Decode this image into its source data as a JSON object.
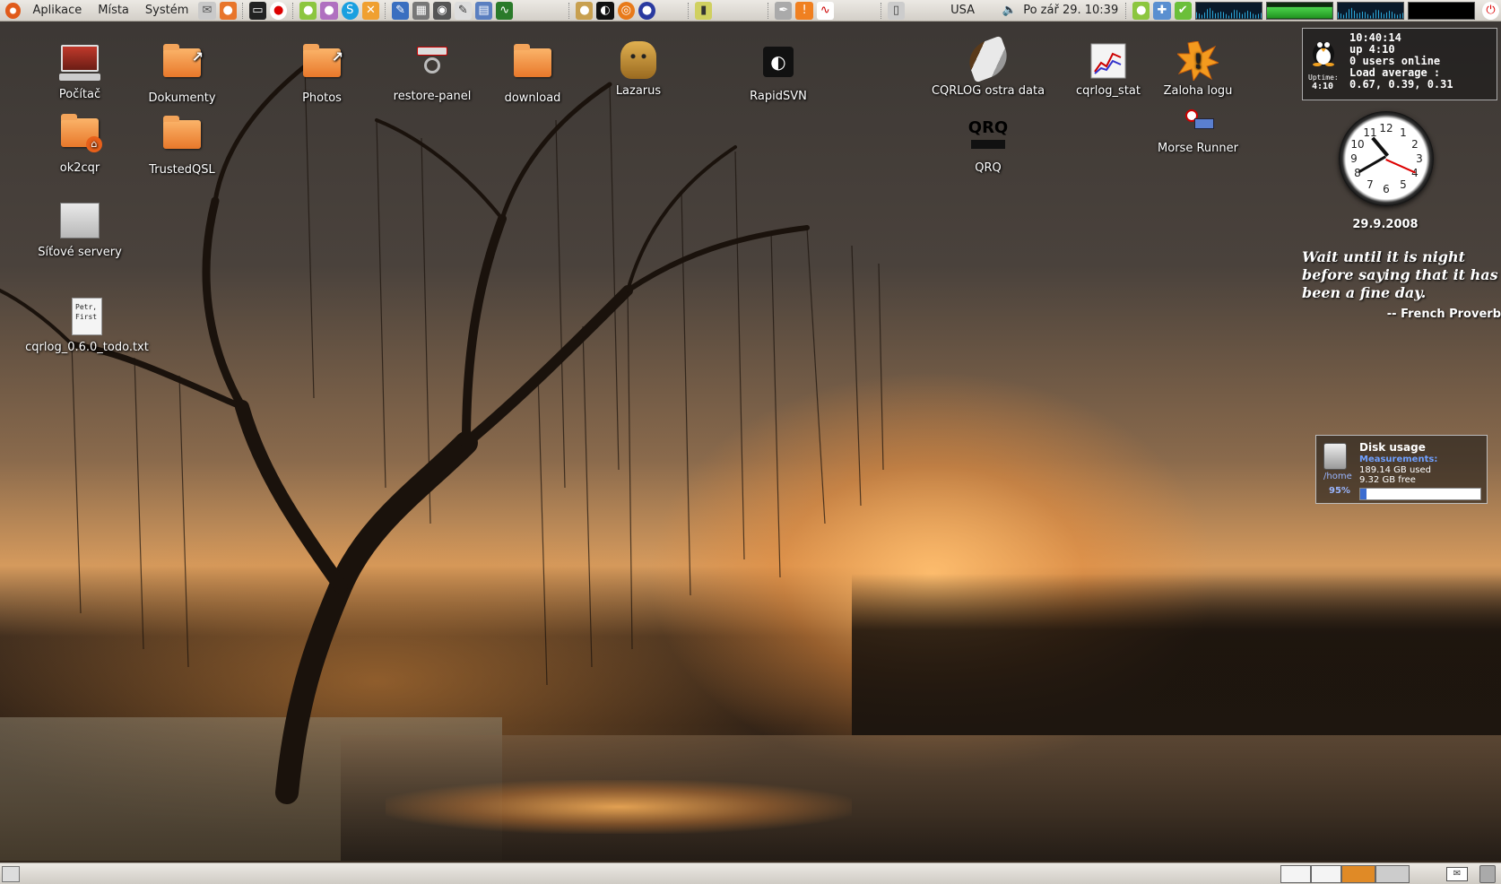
{
  "top_panel": {
    "menus": [
      "Aplikace",
      "Místa",
      "Systém"
    ],
    "keyboard_layout": "USA",
    "datetime": "Po zář 29. 10:39"
  },
  "desktop_icons": [
    {
      "label": "Počítač",
      "icon": "computer-icon"
    },
    {
      "label": "Dokumenty",
      "icon": "folder-link-icon"
    },
    {
      "label": "Photos",
      "icon": "folder-link-icon"
    },
    {
      "label": "restore-panel",
      "icon": "restore-panel-icon"
    },
    {
      "label": "download",
      "icon": "folder-icon"
    },
    {
      "label": "Lazarus",
      "icon": "lazarus-cheetah-icon"
    },
    {
      "label": "RapidSVN",
      "icon": "rapidsvn-icon"
    },
    {
      "label": "CQRLOG ostra data",
      "icon": "cqrlog-feather-icon"
    },
    {
      "label": "cqrlog_stat",
      "icon": "chart-icon"
    },
    {
      "label": "Zaloha logu",
      "icon": "exclamation-burst-icon"
    },
    {
      "label": "ok2cqr",
      "icon": "home-folder-icon"
    },
    {
      "label": "TrustedQSL",
      "icon": "folder-icon"
    },
    {
      "label": "QRQ",
      "icon": "qrq-icon"
    },
    {
      "label": "Morse Runner",
      "icon": "morse-runner-icon"
    },
    {
      "label": "Síťové servery",
      "icon": "network-servers-icon"
    },
    {
      "label": "cqrlog_0.6.0_todo.txt",
      "icon": "text-file-icon"
    }
  ],
  "text_file_preview": [
    "Petr,",
    "First"
  ],
  "sysinfo": {
    "time": "10:40:14",
    "uptime": "up 4:10",
    "users": "0 users online",
    "load_label": "Load average :",
    "load_values": "0.67, 0.39, 0.31",
    "uptime_label": "Uptime:",
    "uptime_short": "4:10"
  },
  "clock": {
    "numbers": [
      "12",
      "1",
      "2",
      "3",
      "4",
      "5",
      "6",
      "7",
      "8",
      "9",
      "10",
      "11"
    ],
    "date": "29.9.2008"
  },
  "quote": {
    "text": "Wait until it is night before saying that it has been a fine day.",
    "author": "-- French Proverb"
  },
  "disk": {
    "title": "Disk usage",
    "measurements_label": "Measurements:",
    "used": "189.14 GB used",
    "free": "9.32 GB free",
    "mount": "/home",
    "percent": "95%",
    "percent_value": 95
  },
  "colors": {
    "panel": "#e0ddd7",
    "folder": "#f08f3c",
    "accent": "#e08a26"
  }
}
